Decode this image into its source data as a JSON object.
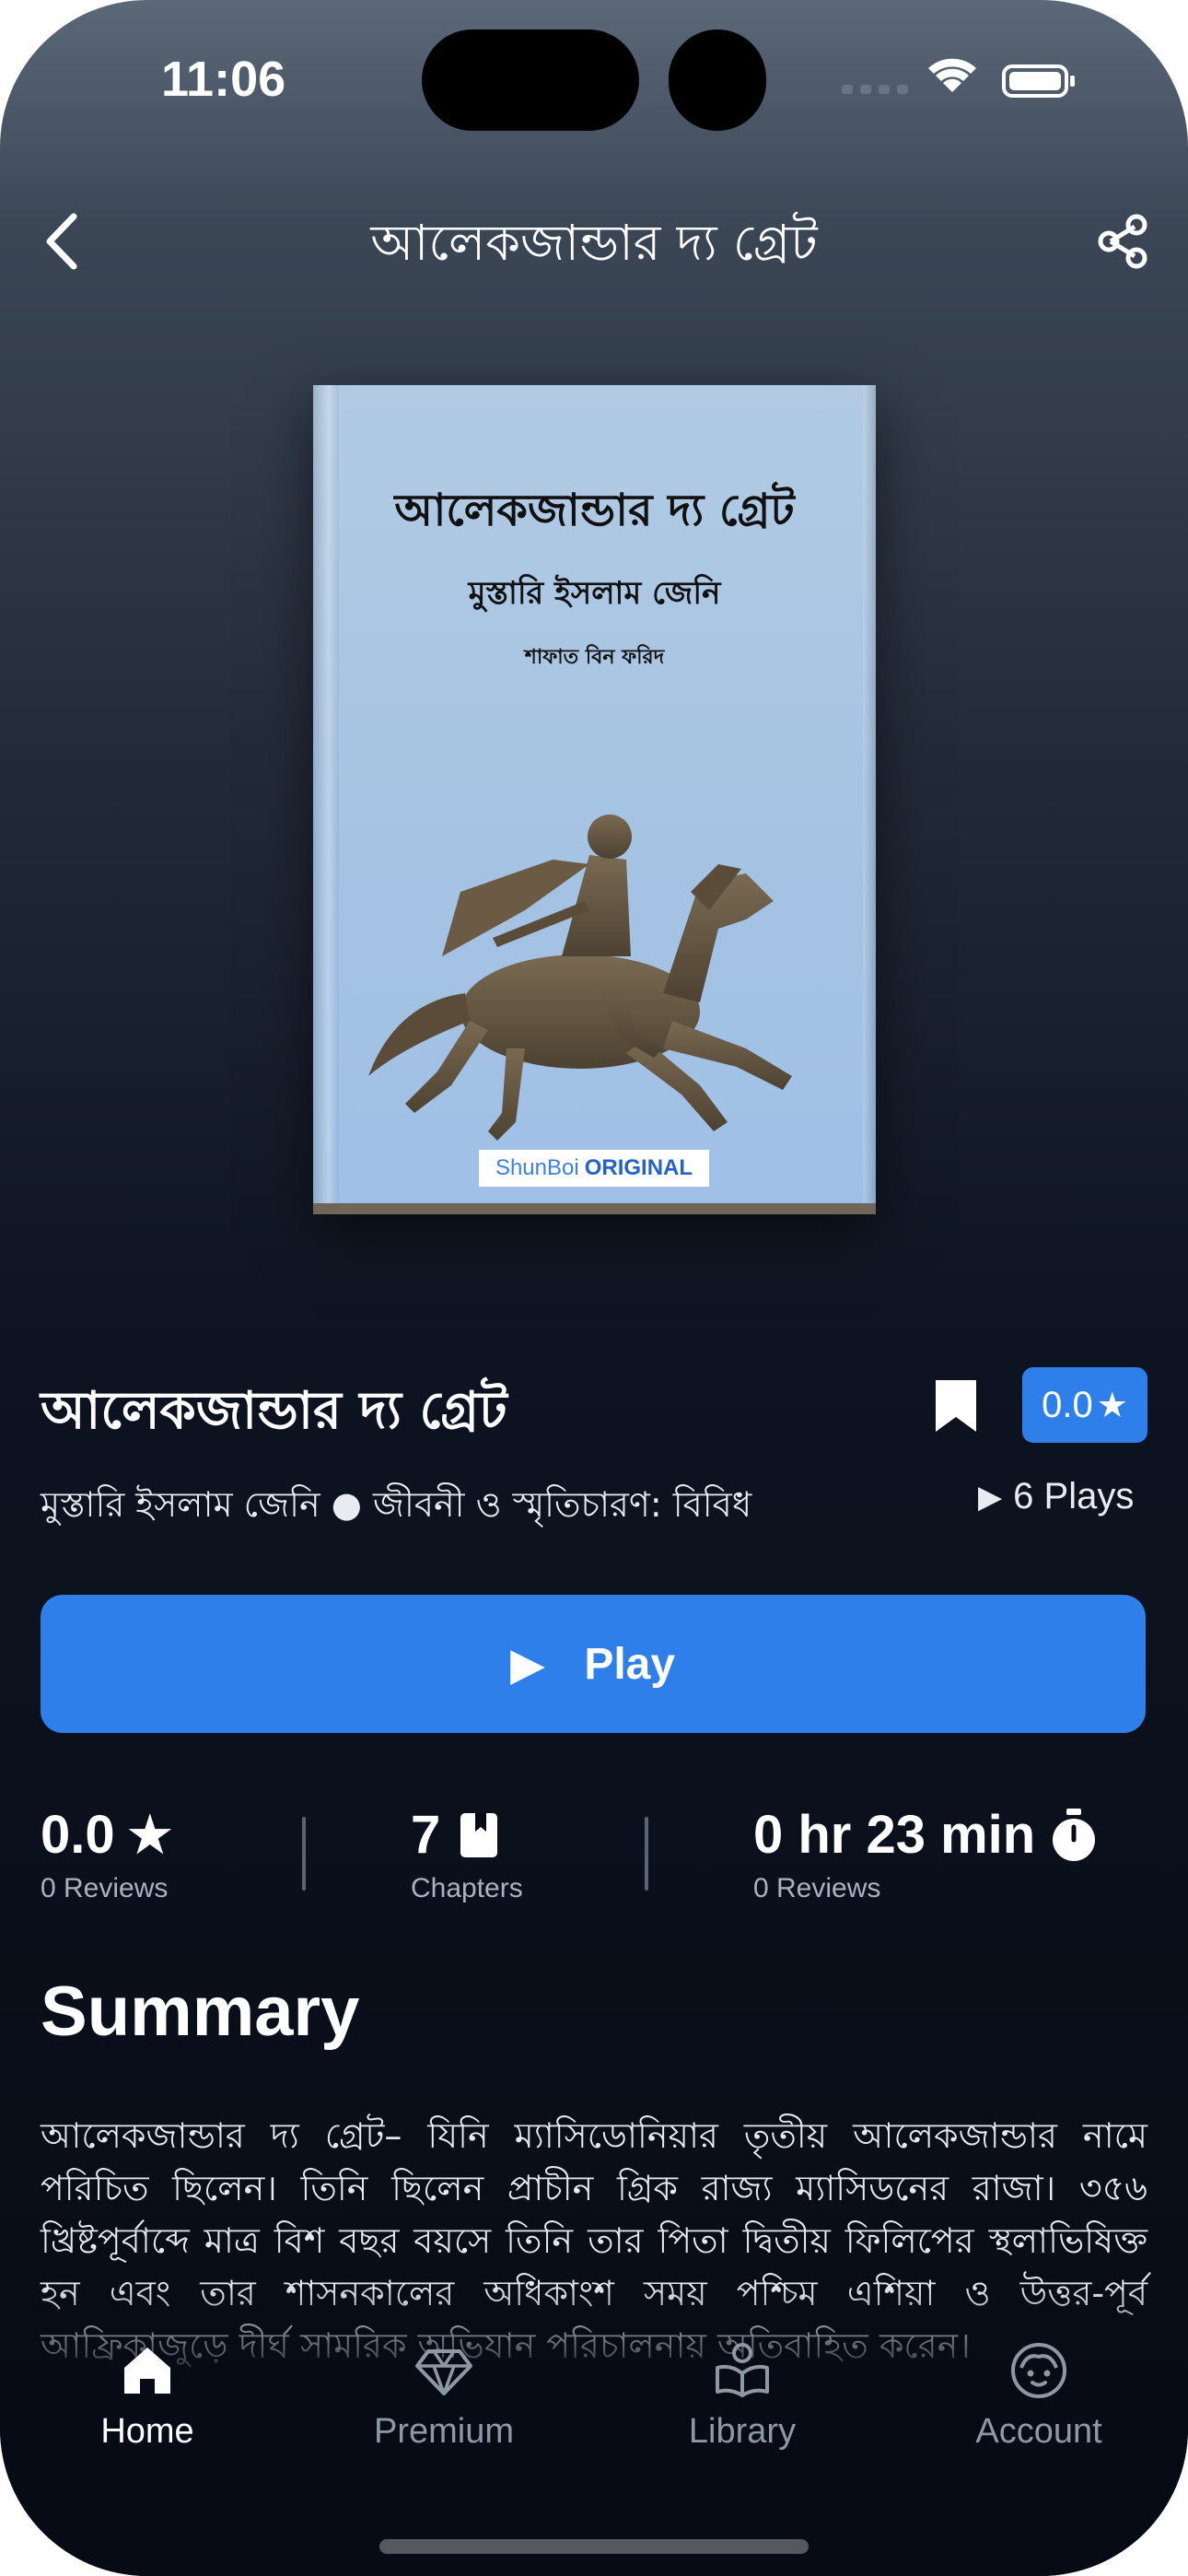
{
  "status_bar": {
    "time": "11:06"
  },
  "header": {
    "title": "আলেকজান্ডার দ্য গ্রেট"
  },
  "cover": {
    "title": "আলেকজান্ডার দ্য গ্রেট",
    "author": "মুস্তারি ইসলাম জেনি",
    "narrator": "শাফাত বিন ফরিদ",
    "brand": "ShunBoi",
    "brand_tag": "ORIGINAL"
  },
  "book": {
    "title": "আলেকজান্ডার দ্য গ্রেট",
    "rating_badge": "0.0",
    "meta": "মুস্তারি ইসলাম জেনি ● জীবনী ও স্মৃতিচারণ: বিবিধ",
    "plays": "6 Plays"
  },
  "play_button": {
    "label": "Play"
  },
  "stats": {
    "rating": {
      "value": "0.0",
      "label": "0 Reviews"
    },
    "chapters": {
      "value": "7",
      "label": "Chapters"
    },
    "duration": {
      "value": "0 hr 23 min",
      "label": "0 Reviews"
    }
  },
  "summary": {
    "heading": "Summary",
    "text": "আলেকজান্ডার দ্য গ্রেট– যিনি ম্যাসিডোনিয়ার তৃতীয় আলেকজান্ডার নামে পরিচিত ছিলেন। তিনি ছিলেন প্রাচীন গ্রিক রাজ্য ম্যাসিডনের রাজা। ৩৫৬ খ্রিষ্টপূর্বাব্দে মাত্র বিশ বছর বয়সে তিনি তার পিতা দ্বিতীয় ফিলিপের স্থলাভিষিক্ত হন এবং তার শাসনকালের অধিকাংশ সময় পশ্চিম এশিয়া ও উত্তর-পূর্ব আফ্রিকাজুড়ে দীর্ঘ সামরিক অভিযান পরিচালনায় অতিবাহিত করেন।"
  },
  "tabs": [
    {
      "label": "Home",
      "icon": "home-icon",
      "active": true
    },
    {
      "label": "Premium",
      "icon": "diamond-icon",
      "active": false
    },
    {
      "label": "Library",
      "icon": "library-icon",
      "active": false
    },
    {
      "label": "Account",
      "icon": "account-icon",
      "active": false
    }
  ],
  "colors": {
    "accent": "#2f7fea",
    "background": "#070b15",
    "muted_text": "#8e97a4"
  }
}
